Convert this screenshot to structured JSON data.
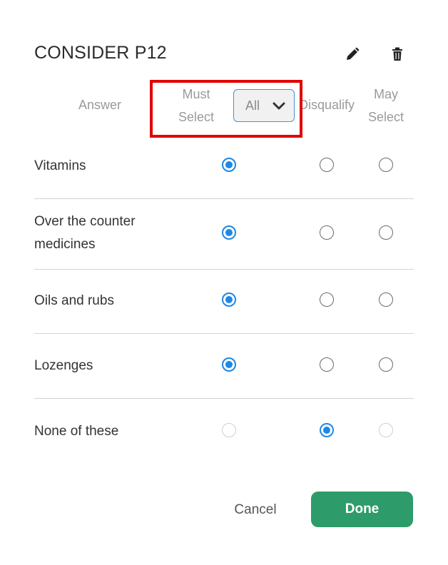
{
  "dialog": {
    "title": "CONSIDER P12",
    "icons": {
      "edit": "pencil-icon",
      "delete": "trash-icon"
    }
  },
  "columns": {
    "answer": "Answer",
    "must_line1": "Must",
    "must_line2": "Select",
    "disqualify": "Disqualify",
    "may_line1": "May",
    "may_line2": "Select"
  },
  "filter": {
    "selected": "All"
  },
  "rows": [
    {
      "label_line1": "Vitamins",
      "label_line2": "",
      "selected": "must"
    },
    {
      "label_line1": "Over the counter",
      "label_line2": "medicines",
      "selected": "must"
    },
    {
      "label_line1": "Oils and rubs",
      "label_line2": "",
      "selected": "must"
    },
    {
      "label_line1": "Lozenges",
      "label_line2": "",
      "selected": "must"
    },
    {
      "label_line1": "None of these",
      "label_line2": "",
      "selected": "disqualify"
    }
  ],
  "footer": {
    "cancel_label": "Cancel",
    "done_label": "Done"
  },
  "colors": {
    "accent": "#1e88e5",
    "done": "#2e9b6a",
    "highlight": "#e00000"
  }
}
